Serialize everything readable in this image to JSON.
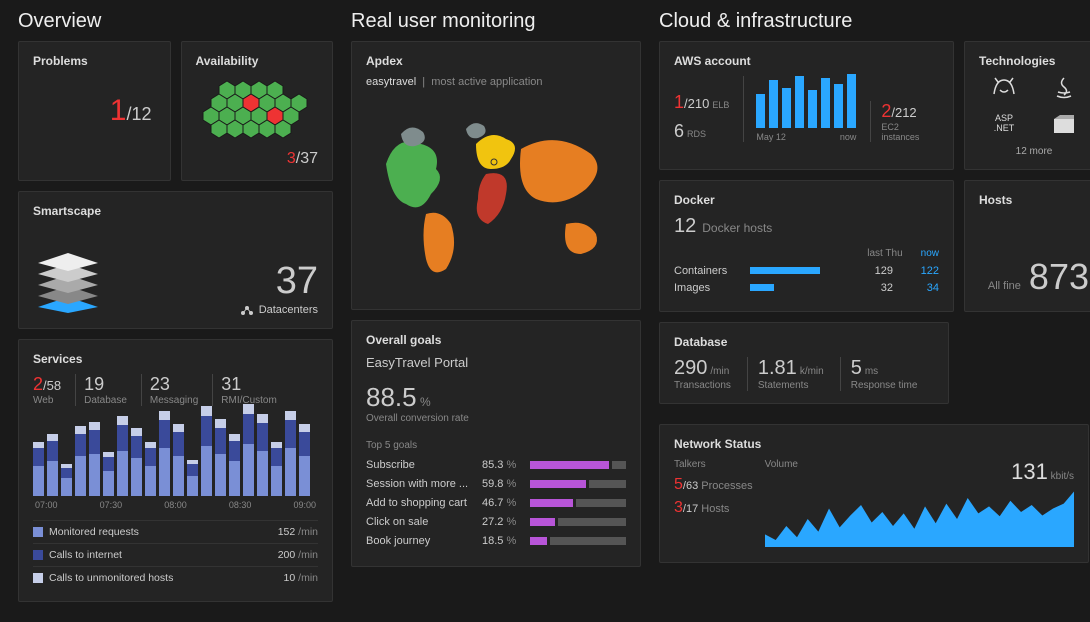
{
  "sections": {
    "overview": "Overview",
    "rum": "Real user monitoring",
    "cloud": "Cloud & infrastructure"
  },
  "problems": {
    "title": "Problems",
    "value": "1",
    "total": "/12"
  },
  "availability": {
    "title": "Availability",
    "value": "3",
    "total": "/37"
  },
  "smartscape": {
    "title": "Smartscape",
    "value": "37",
    "label": "Datacenters"
  },
  "services": {
    "title": "Services",
    "stats": [
      {
        "value": "2",
        "total": "/58",
        "label": "Web",
        "red": true
      },
      {
        "value": "19",
        "label": "Database"
      },
      {
        "value": "23",
        "label": "Messaging"
      },
      {
        "value": "31",
        "label": "RMI/Custom"
      }
    ],
    "ticks": [
      "07:00",
      "07:30",
      "08:00",
      "08:30",
      "09:00"
    ],
    "legend": [
      {
        "color": "#7a8fd6",
        "label": "Monitored requests",
        "value": "152",
        "unit": "/min"
      },
      {
        "color": "#3a4a9a",
        "label": "Calls to internet",
        "value": "200",
        "unit": "/min"
      },
      {
        "color": "#c6cee8",
        "label": "Calls to unmonitored hosts",
        "value": "10",
        "unit": "/min"
      }
    ]
  },
  "apdex": {
    "title": "Apdex",
    "app": "easytravel",
    "subtitle": "most active application"
  },
  "goals": {
    "title": "Overall goals",
    "portal": "EasyTravel Portal",
    "conversion": "88.5",
    "conversion_unit": "%",
    "conversion_label": "Overall conversion rate",
    "top5_label": "Top 5 goals",
    "items": [
      {
        "label": "Subscribe",
        "pct": "85.3"
      },
      {
        "label": "Session with more ...",
        "pct": "59.8"
      },
      {
        "label": "Add to shopping cart",
        "pct": "46.7"
      },
      {
        "label": "Click on sale",
        "pct": "27.2"
      },
      {
        "label": "Book journey",
        "pct": "18.5"
      }
    ],
    "pct_unit": "%"
  },
  "aws": {
    "title": "AWS account",
    "elb": {
      "v": "1",
      "t": "/210",
      "u": "ELB"
    },
    "rds": {
      "v": "6",
      "u": "RDS"
    },
    "ec2": {
      "v": "2",
      "t": "/212",
      "u": "EC2 instances"
    },
    "ticks": [
      "May 12",
      "now"
    ]
  },
  "tech": {
    "title": "Technologies",
    "more": "12 more",
    "items": [
      "tomcat",
      "java",
      "aspnet",
      "other"
    ]
  },
  "docker": {
    "title": "Docker",
    "hosts_n": "12",
    "hosts_l": "Docker hosts",
    "cols": [
      "last Thu",
      "now"
    ],
    "rows": [
      {
        "label": "Containers",
        "w": 72,
        "a": "129",
        "b": "122"
      },
      {
        "label": "Images",
        "w": 25,
        "a": "32",
        "b": "34"
      }
    ]
  },
  "hosts": {
    "title": "Hosts",
    "label": "All fine",
    "value": "873"
  },
  "database": {
    "title": "Database",
    "stats": [
      {
        "v": "290",
        "u": "/min",
        "l": "Transactions"
      },
      {
        "v": "1.81",
        "u": "k/min",
        "l": "Statements"
      },
      {
        "v": "5",
        "u": "ms",
        "l": "Response time"
      }
    ]
  },
  "network": {
    "title": "Network Status",
    "talkers": "Talkers",
    "proc": {
      "v": "5",
      "t": "/63",
      "l": "Processes"
    },
    "host": {
      "v": "3",
      "t": "/17",
      "l": "Hosts"
    },
    "volume_l": "Volume",
    "volume_v": "131",
    "volume_u": "kbit/s"
  },
  "chart_data": {
    "services_bars": {
      "type": "bar",
      "stacked": true,
      "x_ticks": [
        "07:00",
        "07:30",
        "08:00",
        "08:30",
        "09:00"
      ],
      "series": [
        {
          "name": "Monitored requests",
          "color": "#7a8fd6",
          "values": [
            30,
            35,
            18,
            40,
            42,
            25,
            45,
            38,
            30,
            48,
            40,
            20,
            50,
            42,
            35,
            52,
            45,
            30,
            48,
            40
          ]
        },
        {
          "name": "Calls to internet",
          "color": "#3a4a9a",
          "values": [
            18,
            20,
            10,
            22,
            24,
            14,
            26,
            22,
            18,
            28,
            24,
            12,
            30,
            26,
            20,
            30,
            28,
            18,
            28,
            24
          ]
        },
        {
          "name": "Calls to unmonitored hosts",
          "color": "#c6cee8",
          "values": [
            6,
            7,
            4,
            8,
            8,
            5,
            9,
            8,
            6,
            9,
            8,
            4,
            10,
            9,
            7,
            10,
            9,
            6,
            9,
            8
          ]
        }
      ]
    },
    "aws_bars": {
      "type": "bar",
      "x_ticks": [
        "May 12",
        "now"
      ],
      "values": [
        34,
        48,
        40,
        52,
        38,
        50,
        44,
        54
      ]
    },
    "network_area": {
      "type": "area",
      "points": [
        18,
        10,
        30,
        14,
        40,
        22,
        55,
        28,
        45,
        60,
        35,
        50,
        30,
        48,
        26,
        58,
        34,
        62,
        40,
        70,
        48,
        58,
        44,
        66,
        50,
        60,
        45,
        55,
        62,
        80
      ]
    }
  }
}
